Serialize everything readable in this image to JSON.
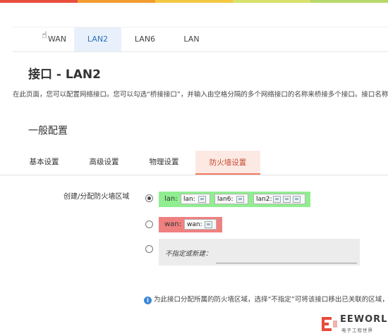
{
  "top_bar_colors": [
    "#e94e3b",
    "#f39c2f",
    "#f5c842",
    "#d7e26a",
    "#b9d86b"
  ],
  "interface_tabs": [
    {
      "label": "WAN",
      "active": false
    },
    {
      "label": "LAN2",
      "active": true
    },
    {
      "label": "LAN6",
      "active": false
    },
    {
      "label": "LAN",
      "active": false
    }
  ],
  "page_title": "接口 - LAN2",
  "description": "在此页面，您可以配置网络接口。您可以勾选“桥接接口”，并输入由空格分隔的多个网络接口的名称来桥接多个接口。接口名称中",
  "section_title": "一般配置",
  "sub_tabs": [
    {
      "label": "基本设置",
      "active": false
    },
    {
      "label": "高级设置",
      "active": false
    },
    {
      "label": "物理设置",
      "active": false
    },
    {
      "label": "防火墙设置",
      "active": true
    }
  ],
  "firewall_field": {
    "label": "创建/分配防火墙区域",
    "zones": [
      {
        "name": "lan:",
        "color": "#90ee90",
        "checked": true,
        "interfaces": [
          {
            "name": "lan:",
            "icons": 1
          },
          {
            "name": "lan6:",
            "icons": 1
          },
          {
            "name": "lan2:",
            "icons": 3
          }
        ]
      },
      {
        "name": "wan:",
        "color": "#f08080",
        "checked": false,
        "interfaces": [
          {
            "name": "wan:",
            "icons": 1
          }
        ]
      }
    ],
    "unspecified_label": "不指定或新建："
  },
  "help_text": "为此接口分配所属的防火墙区域，选择“不指定”可将该接口移出已关联的区域，",
  "watermark": {
    "brand": "EEWORLD",
    "subtitle": "电子工程世界"
  }
}
